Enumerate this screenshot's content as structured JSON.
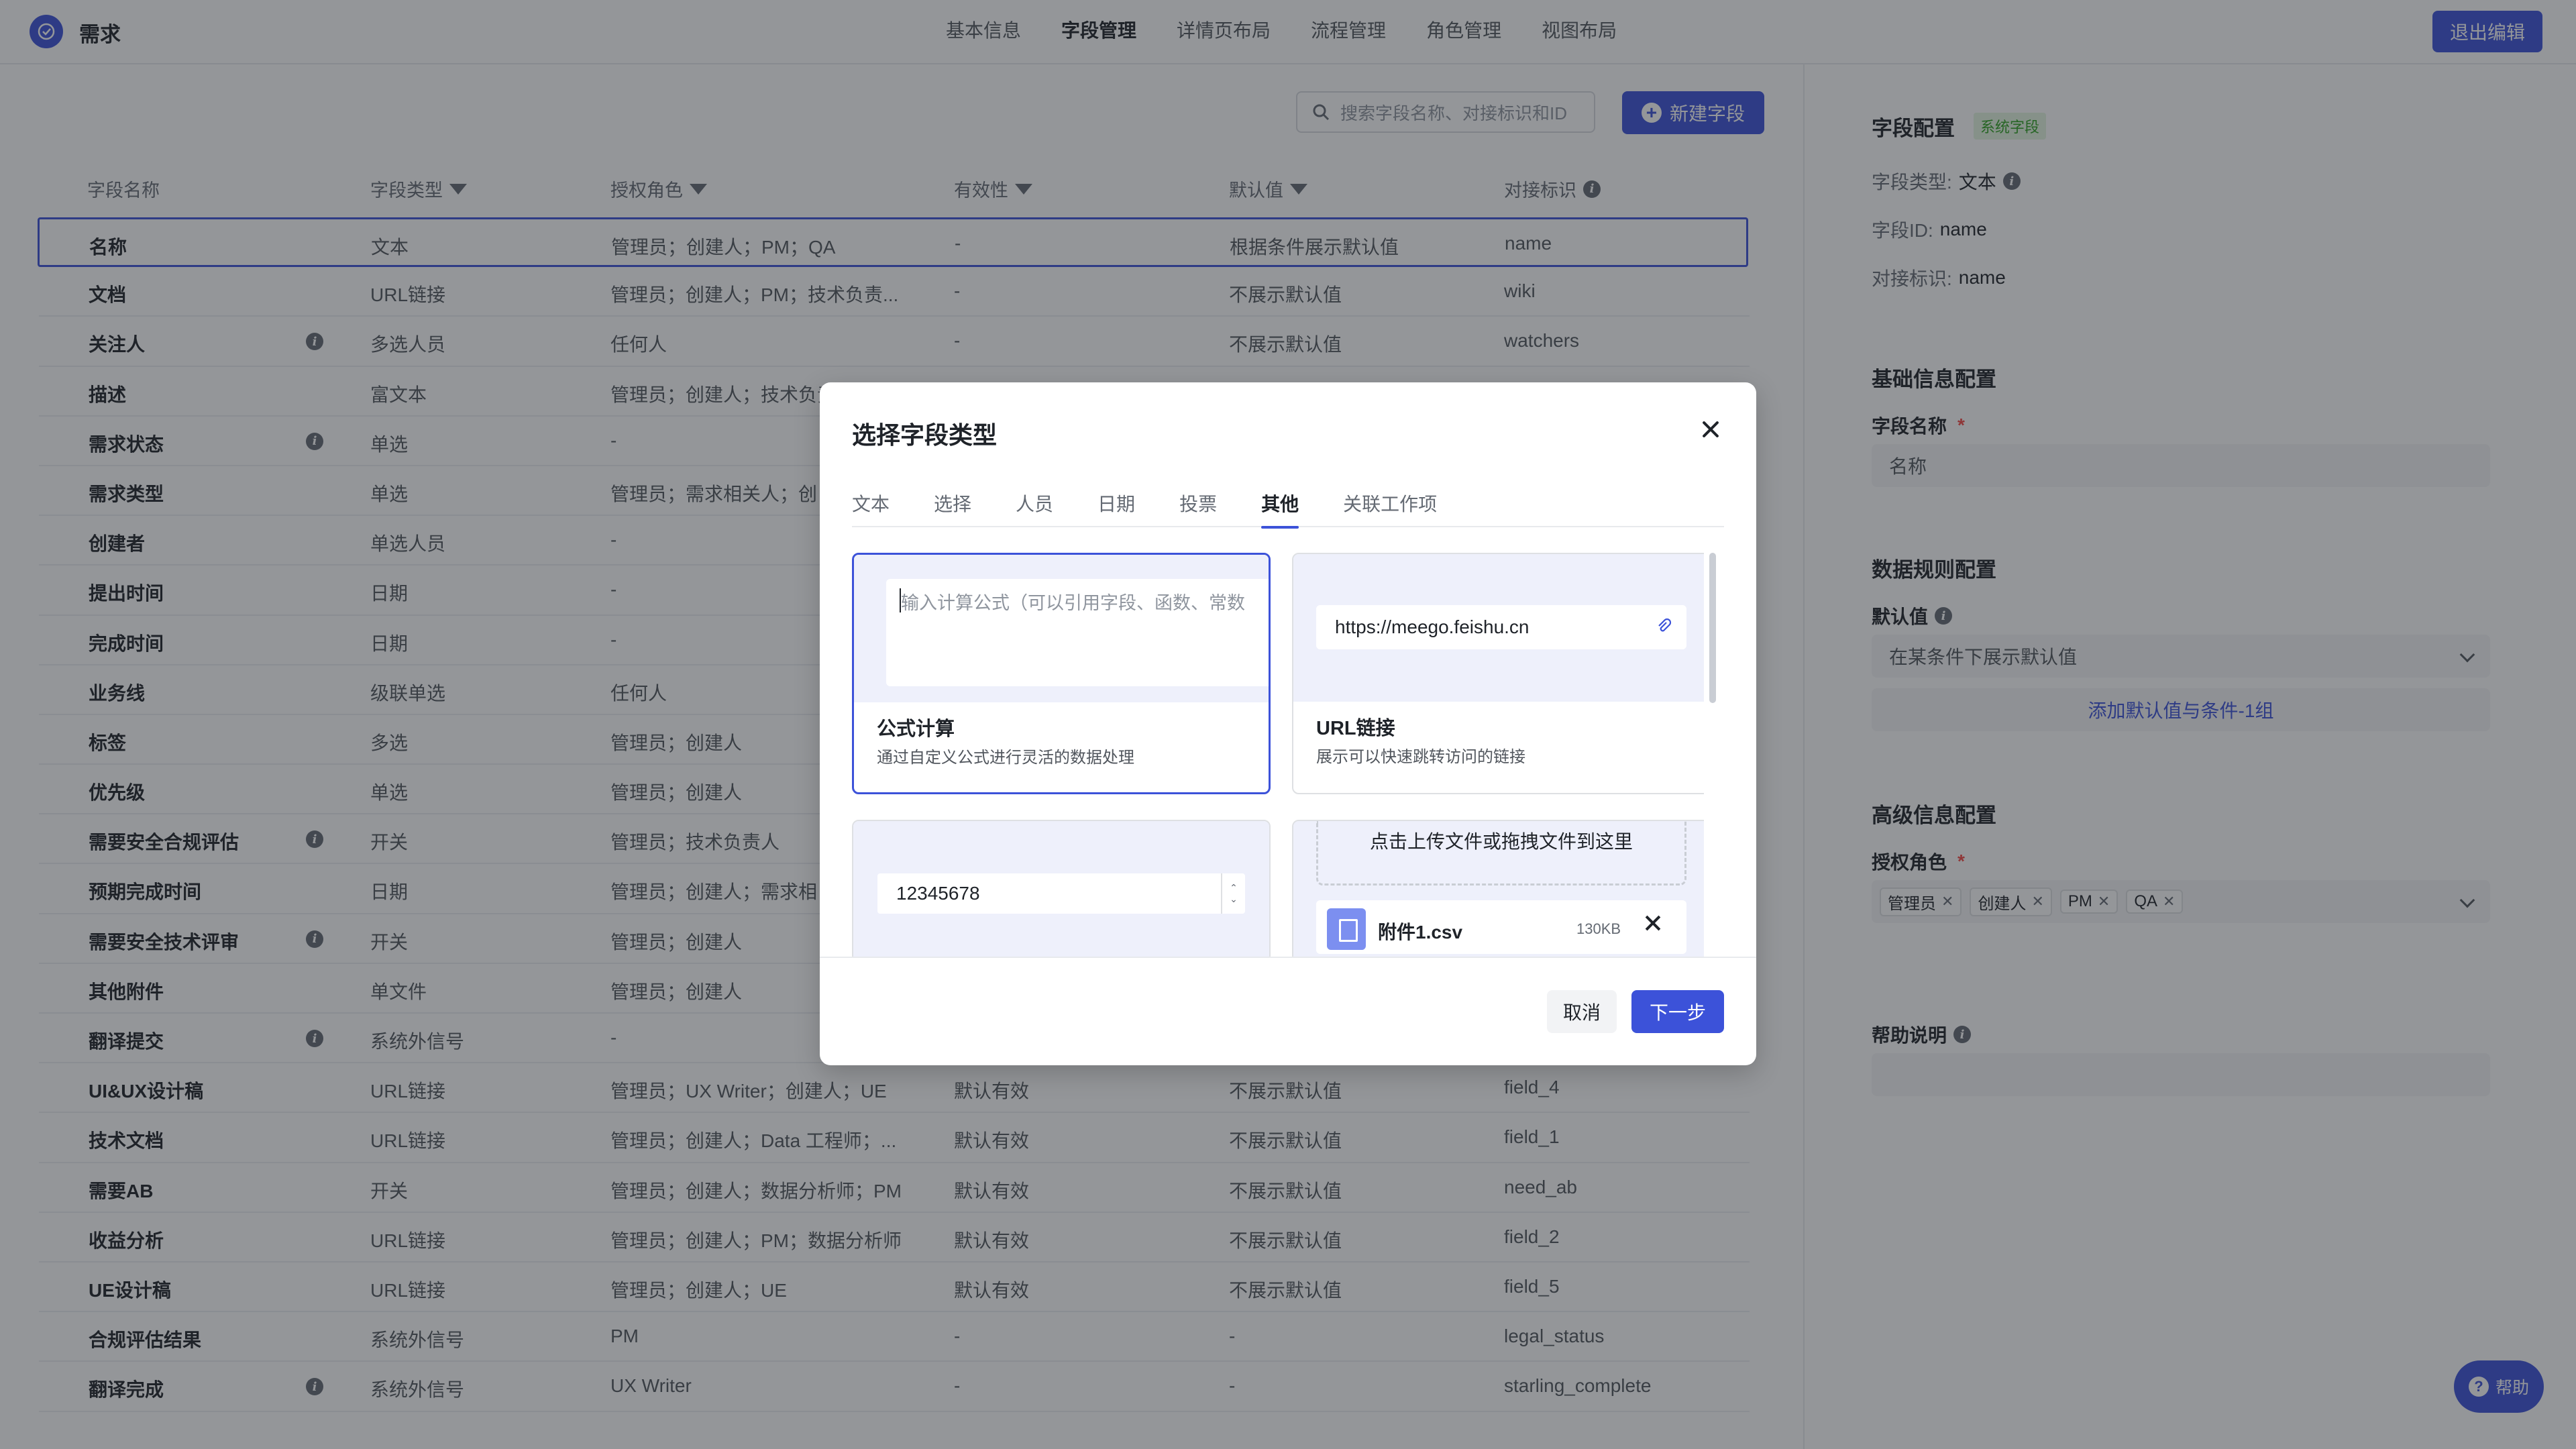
{
  "app": {
    "title": "需求",
    "exit_label": "退出编辑"
  },
  "nav": [
    "基本信息",
    "字段管理",
    "详情页布局",
    "流程管理",
    "角色管理",
    "视图布局"
  ],
  "toolbar": {
    "search_placeholder": "搜索字段名称、对接标识和ID",
    "new_label": "新建字段"
  },
  "table": {
    "headers": [
      "字段名称",
      "字段类型",
      "授权角色",
      "有效性",
      "默认值",
      "对接标识"
    ],
    "rows": [
      {
        "name": "名称",
        "type": "文本",
        "roles": "管理员；创建人；PM；QA",
        "valid": "-",
        "default": "根据条件展示默认值",
        "key": "name",
        "info": false
      },
      {
        "name": "文档",
        "type": "URL链接",
        "roles": "管理员；创建人；PM；技术负责...",
        "valid": "-",
        "default": "不展示默认值",
        "key": "wiki",
        "info": false
      },
      {
        "name": "关注人",
        "type": "多选人员",
        "roles": "任何人",
        "valid": "-",
        "default": "不展示默认值",
        "key": "watchers",
        "info": true
      },
      {
        "name": "描述",
        "type": "富文本",
        "roles": "管理员；创建人；技术负责",
        "valid": "",
        "default": "",
        "key": "",
        "info": false
      },
      {
        "name": "需求状态",
        "type": "单选",
        "roles": "-",
        "valid": "",
        "default": "",
        "key": "",
        "info": true
      },
      {
        "name": "需求类型",
        "type": "单选",
        "roles": "管理员；需求相关人；创",
        "valid": "",
        "default": "",
        "key": "",
        "info": false
      },
      {
        "name": "创建者",
        "type": "单选人员",
        "roles": "-",
        "valid": "",
        "default": "",
        "key": "",
        "info": false
      },
      {
        "name": "提出时间",
        "type": "日期",
        "roles": "-",
        "valid": "",
        "default": "",
        "key": "",
        "info": false
      },
      {
        "name": "完成时间",
        "type": "日期",
        "roles": "-",
        "valid": "",
        "default": "",
        "key": "",
        "info": false
      },
      {
        "name": "业务线",
        "type": "级联单选",
        "roles": "任何人",
        "valid": "",
        "default": "",
        "key": "",
        "info": false
      },
      {
        "name": "标签",
        "type": "多选",
        "roles": "管理员；创建人",
        "valid": "",
        "default": "",
        "key": "",
        "info": false
      },
      {
        "name": "优先级",
        "type": "单选",
        "roles": "管理员；创建人",
        "valid": "",
        "default": "",
        "key": "",
        "info": false
      },
      {
        "name": "需要安全合规评估",
        "type": "开关",
        "roles": "管理员；技术负责人",
        "valid": "",
        "default": "",
        "key": "",
        "info": true
      },
      {
        "name": "预期完成时间",
        "type": "日期",
        "roles": "管理员；创建人；需求相",
        "valid": "",
        "default": "",
        "key": "",
        "info": false
      },
      {
        "name": "需要安全技术评审",
        "type": "开关",
        "roles": "管理员；创建人",
        "valid": "",
        "default": "",
        "key": "",
        "info": true
      },
      {
        "name": "其他附件",
        "type": "单文件",
        "roles": "管理员；创建人",
        "valid": "",
        "default": "",
        "key": "",
        "info": false
      },
      {
        "name": "翻译提交",
        "type": "系统外信号",
        "roles": "-",
        "valid": "",
        "default": "",
        "key": "",
        "info": true
      },
      {
        "name": "UI&UX设计稿",
        "type": "URL链接",
        "roles": "管理员；UX Writer；创建人；UE",
        "valid": "默认有效",
        "default": "不展示默认值",
        "key": "field_4",
        "info": false
      },
      {
        "name": "技术文档",
        "type": "URL链接",
        "roles": "管理员；创建人；Data 工程师；...",
        "valid": "默认有效",
        "default": "不展示默认值",
        "key": "field_1",
        "info": false
      },
      {
        "name": "需要AB",
        "type": "开关",
        "roles": "管理员；创建人；数据分析师；PM",
        "valid": "默认有效",
        "default": "不展示默认值",
        "key": "need_ab",
        "info": false
      },
      {
        "name": "收益分析",
        "type": "URL链接",
        "roles": "管理员；创建人；PM；数据分析师",
        "valid": "默认有效",
        "default": "不展示默认值",
        "key": "field_2",
        "info": false
      },
      {
        "name": "UE设计稿",
        "type": "URL链接",
        "roles": "管理员；创建人；UE",
        "valid": "默认有效",
        "default": "不展示默认值",
        "key": "field_5",
        "info": false
      },
      {
        "name": "合规评估结果",
        "type": "系统外信号",
        "roles": "PM",
        "valid": "-",
        "default": "-",
        "key": "legal_status",
        "info": false
      },
      {
        "name": "翻译完成",
        "type": "系统外信号",
        "roles": "UX Writer",
        "valid": "-",
        "default": "-",
        "key": "starling_complete",
        "info": true
      }
    ]
  },
  "panel": {
    "title": "字段配置",
    "sys_tag": "系统字段",
    "type_label": "字段类型:",
    "type_value": "文本",
    "id_label": "字段ID:",
    "id_value": "name",
    "key_label": "对接标识:",
    "key_value": "name",
    "basic_title": "基础信息配置",
    "field_name_label": "字段名称",
    "field_name_value": "名称",
    "rules_title": "数据规则配置",
    "default_label": "默认值",
    "default_value": "在某条件下展示默认值",
    "add_default": "添加默认值与条件-1组",
    "adv_title": "高级信息配置",
    "roles_label": "授权角色",
    "roles": [
      "管理员",
      "创建人",
      "PM",
      "QA"
    ],
    "help_label": "帮助说明"
  },
  "help_fab": "帮助",
  "modal": {
    "title": "选择字段类型",
    "tabs": [
      "文本",
      "选择",
      "人员",
      "日期",
      "投票",
      "其他",
      "关联工作项"
    ],
    "active_tab": "其他",
    "cards": {
      "formula": {
        "placeholder": "输入计算公式（可以引用字段、函数、常数",
        "name": "公式计算",
        "desc": "通过自定义公式进行灵活的数据处理"
      },
      "url": {
        "value": "https://meego.feishu.cn",
        "name": "URL链接",
        "desc": "展示可以快速跳转访问的链接"
      },
      "number": {
        "value": "12345678"
      },
      "file": {
        "upload_text": "点击上传文件或拖拽文件到这里",
        "file_name": "附件1.csv",
        "file_size": "130KB"
      }
    },
    "cancel": "取消",
    "next": "下一步"
  },
  "colors": {
    "primary": "#3c52d9",
    "overlay": "rgba(31,35,41,0.48)"
  }
}
